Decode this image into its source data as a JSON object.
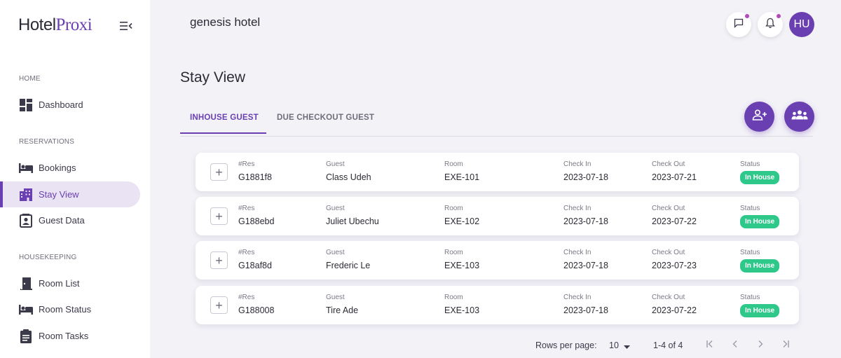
{
  "logo": {
    "part1": "Hotel",
    "part2": "Proxi"
  },
  "sidebar": {
    "sections": [
      {
        "label": "HOME"
      },
      {
        "label": "RESERVATIONS"
      },
      {
        "label": "HOUSEKEEPING"
      }
    ],
    "items": [
      {
        "label": "Dashboard",
        "icon": "dashboard-icon"
      },
      {
        "label": "Bookings",
        "icon": "bed-icon"
      },
      {
        "label": "Stay View",
        "icon": "building-icon",
        "active": true
      },
      {
        "label": "Guest Data",
        "icon": "id-card-icon"
      },
      {
        "label": "Room List",
        "icon": "door-icon"
      },
      {
        "label": "Room Status",
        "icon": "bed-icon"
      },
      {
        "label": "Room Tasks",
        "icon": "clipboard-icon"
      }
    ]
  },
  "header": {
    "hotel_name": "genesis hotel",
    "avatar_initials": "HU"
  },
  "page": {
    "title": "Stay View"
  },
  "tabs": [
    {
      "label": "INHOUSE GUEST",
      "active": true
    },
    {
      "label": "DUE CHECKOUT GUEST",
      "active": false
    }
  ],
  "columns": {
    "res": "#Res",
    "guest": "Guest",
    "room": "Room",
    "check_in": "Check In",
    "check_out": "Check Out",
    "status": "Status"
  },
  "reservations": [
    {
      "res": "G1881f8",
      "guest": "Class Udeh",
      "room": "EXE-101",
      "check_in": "2023-07-18",
      "check_out": "2023-07-21",
      "status": "In House"
    },
    {
      "res": "G188ebd",
      "guest": "Juliet Ubechu",
      "room": "EXE-102",
      "check_in": "2023-07-18",
      "check_out": "2023-07-22",
      "status": "In House"
    },
    {
      "res": "G18af8d",
      "guest": "Frederic Le",
      "room": "EXE-103",
      "check_in": "2023-07-18",
      "check_out": "2023-07-23",
      "status": "In House"
    },
    {
      "res": "G188008",
      "guest": "Tire Ade",
      "room": "EXE-103",
      "check_in": "2023-07-18",
      "check_out": "2023-07-22",
      "status": "In House"
    }
  ],
  "pagination": {
    "rows_label": "Rows per page:",
    "rows_value": "10",
    "range": "1-4 of 4"
  },
  "colors": {
    "accent": "#6a3fb1",
    "status_green": "#2ec98a",
    "notification_dot": "#b24bb8"
  }
}
